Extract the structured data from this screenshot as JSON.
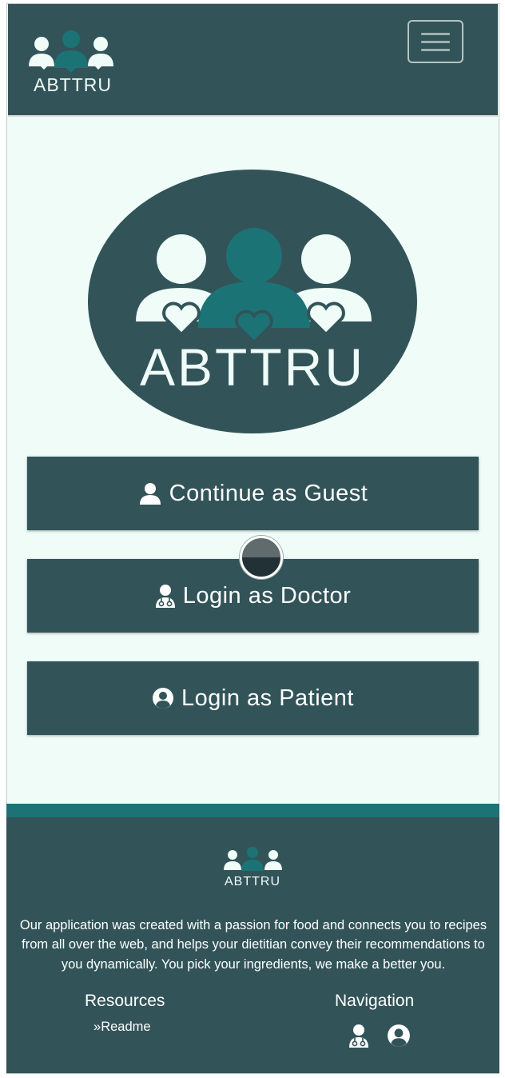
{
  "app": {
    "brand": "ABTTRU"
  },
  "navbar": {
    "toggle_icon": "hamburger-menu-icon"
  },
  "hero": {
    "logo_text": "ABTTRU"
  },
  "actions": {
    "guest": {
      "label": "Continue as Guest",
      "icon": "user-icon"
    },
    "doctor": {
      "label": "Login as Doctor",
      "icon": "user-doctor-icon"
    },
    "patient": {
      "label": "Login as Patient",
      "icon": "user-circle-icon"
    }
  },
  "footer": {
    "logo_text": "ABTTRU",
    "about": "Our application was created with a passion for food and connects you to recipes from all over the web, and helps your dietitian convey their recommendations to you dynamically. You pick your ingredients, we make a better you.",
    "resources_title": "Resources",
    "readme_prefix": "»",
    "readme_label": "Readme",
    "navigation_title": "Navigation"
  },
  "colors": {
    "primary": "#325458",
    "accent": "#1c7376",
    "background": "#effcf8",
    "text_light": "#ffffff"
  }
}
